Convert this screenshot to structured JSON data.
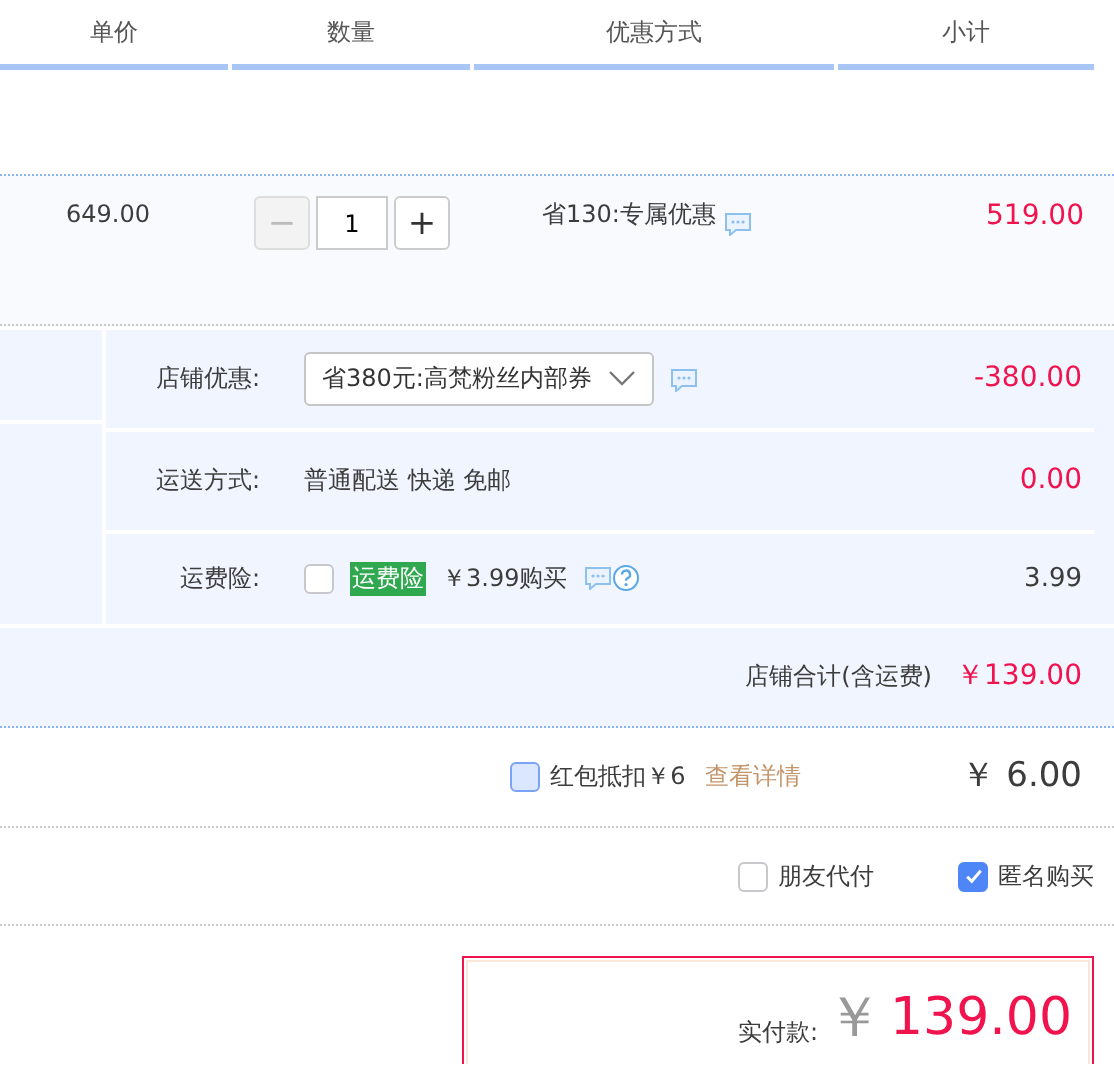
{
  "columns": [
    {
      "label": "单价"
    },
    {
      "label": "数量"
    },
    {
      "label": "优惠方式"
    },
    {
      "label": "小计"
    }
  ],
  "item": {
    "unit_price": "649.00",
    "minus": "−",
    "quantity": "1",
    "plus": "+",
    "discount": "省130:专属优惠",
    "subtotal": "519.00"
  },
  "shop": {
    "rows": [
      {
        "kind": "select",
        "label": "店铺优惠:",
        "value": "省380元:高梵粉丝内部券",
        "amount": "-380.00"
      },
      {
        "kind": "text",
        "label": "运送方式:",
        "value": "普通配送 快递 免邮",
        "amount": "0.00"
      },
      {
        "kind": "insurance",
        "label": "运费险:",
        "checked": false,
        "tag": "运费险",
        "value": "￥3.99购买",
        "amount": "3.99"
      }
    ],
    "total_label": "店铺合计(含运费)",
    "total": "￥139.00"
  },
  "red_packet": {
    "checked": false,
    "label": "红包抵扣￥6",
    "link": "查看详情",
    "amount": "￥ 6.00"
  },
  "options": [
    {
      "label": "朋友代付",
      "checked": false
    },
    {
      "label": "匿名购买",
      "checked": true
    }
  ],
  "payment": {
    "label": "实付款:",
    "currency": "￥",
    "amount": "139.00"
  }
}
